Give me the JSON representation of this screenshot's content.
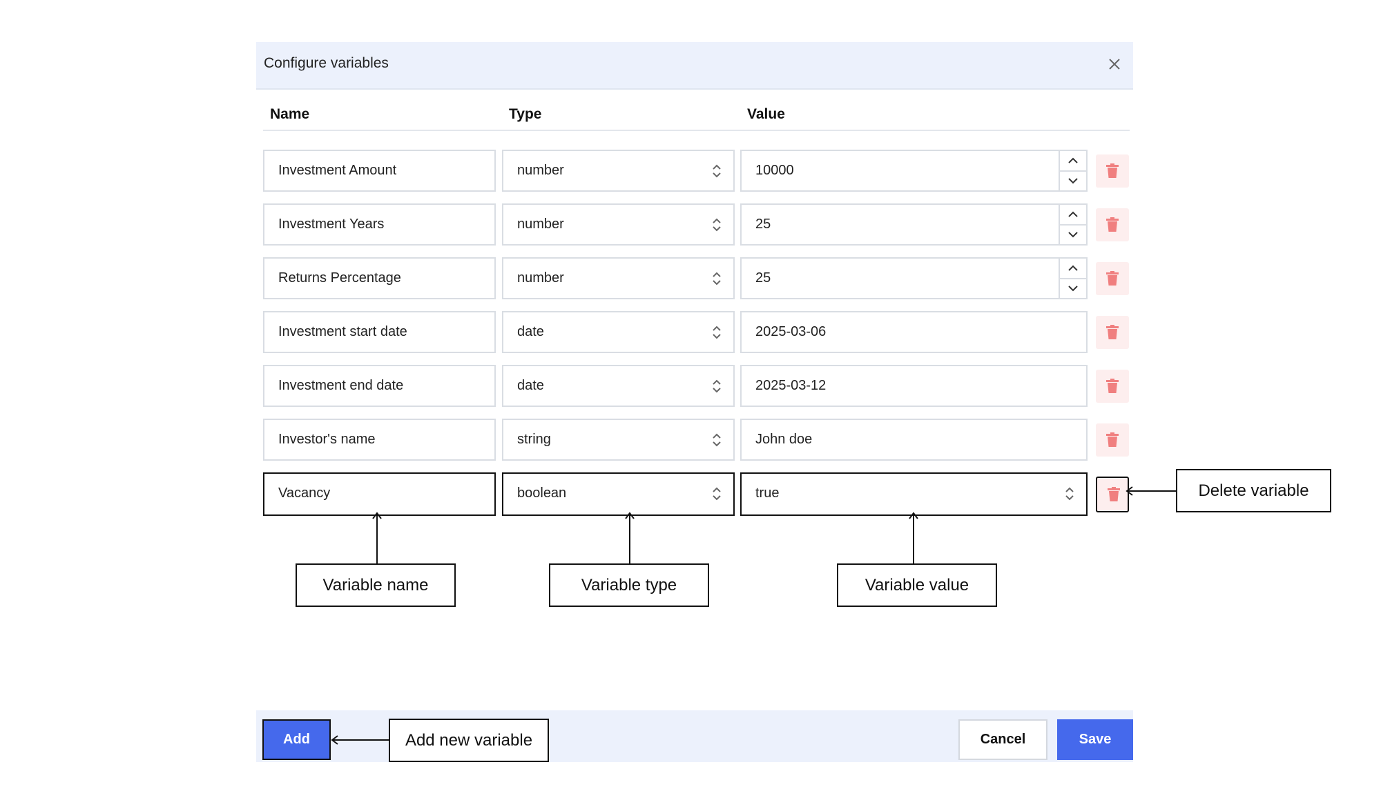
{
  "dialog": {
    "title": "Configure variables",
    "close_icon": "close-icon"
  },
  "columns": {
    "name": "Name",
    "type": "Type",
    "value": "Value"
  },
  "rows": [
    {
      "name": "Investment Amount",
      "type": "number",
      "value": "10000"
    },
    {
      "name": "Investment Years",
      "type": "number",
      "value": "25"
    },
    {
      "name": "Returns Percentage",
      "type": "number",
      "value": "25"
    },
    {
      "name": "Investment start date",
      "type": "date",
      "value": "2025-03-06"
    },
    {
      "name": "Investment end date",
      "type": "date",
      "value": "2025-03-12"
    },
    {
      "name": "Investor's name",
      "type": "string",
      "value": "John doe"
    },
    {
      "name": "Vacancy",
      "type": "boolean",
      "value": "true"
    }
  ],
  "footer": {
    "add_label": "Add",
    "cancel_label": "Cancel",
    "save_label": "Save"
  },
  "annotations": {
    "delete_variable": "Delete variable",
    "variable_name": "Variable name",
    "variable_type": "Variable type",
    "variable_value": "Variable value",
    "add_new_variable": "Add new variable"
  },
  "colors": {
    "header_bg": "#ecf1fc",
    "primary": "#4569ec",
    "delete_icon": "#f07f7f",
    "delete_bg": "#fdeeee"
  }
}
